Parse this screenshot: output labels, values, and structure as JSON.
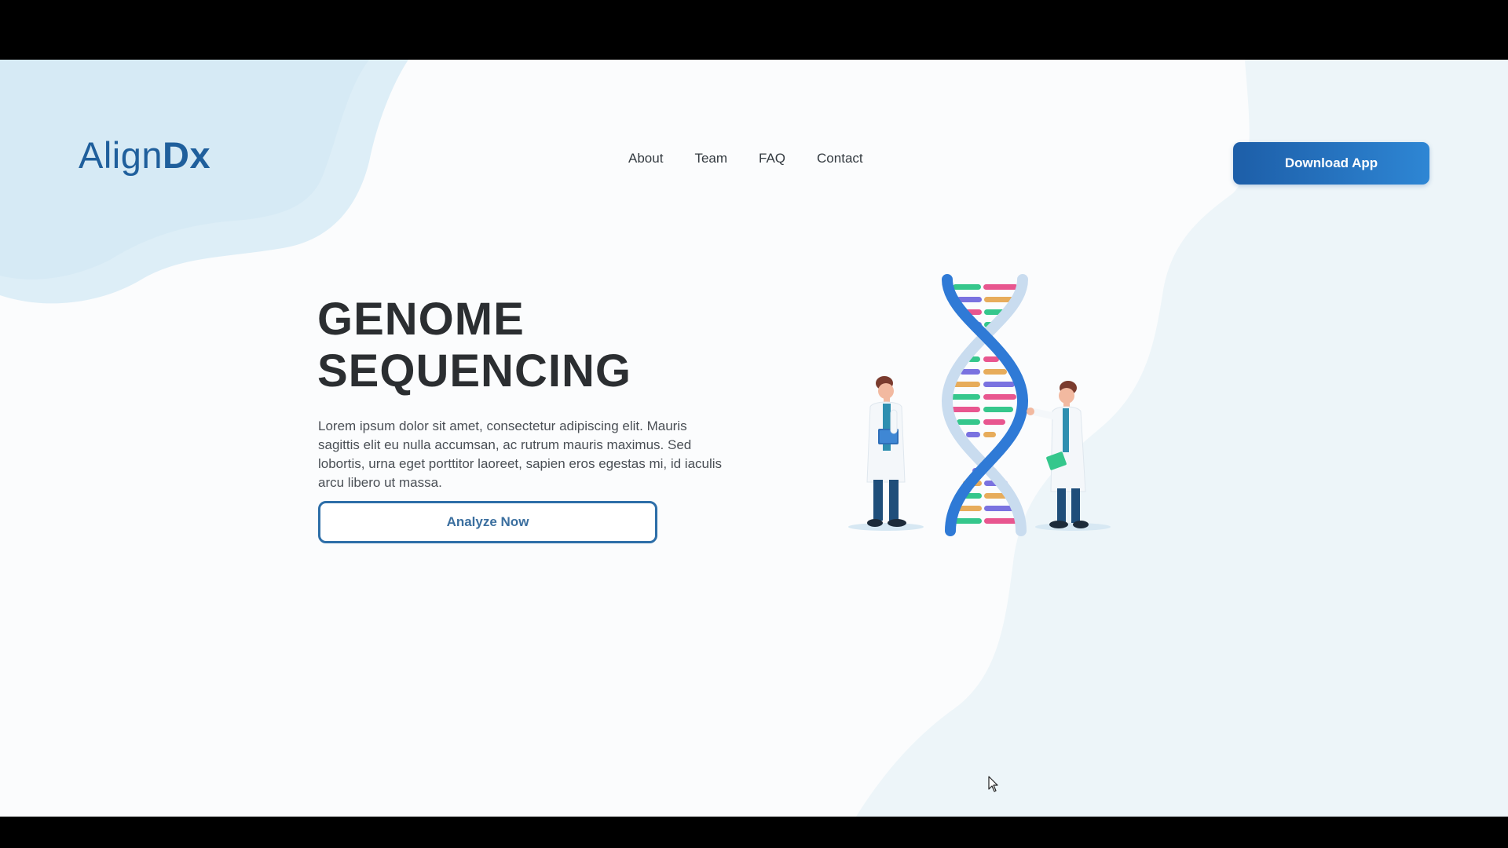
{
  "brand": {
    "name_light": "Align",
    "name_bold": "Dx",
    "color": "#1f5f9c"
  },
  "nav": {
    "items": [
      {
        "label": "About"
      },
      {
        "label": "Team"
      },
      {
        "label": "FAQ"
      },
      {
        "label": "Contact"
      }
    ]
  },
  "header": {
    "download_label": "Download App"
  },
  "hero": {
    "title_line1": "GENOME",
    "title_line2": "SEQUENCING",
    "description": "Lorem ipsum dolor sit amet, consectetur adipiscing elit. Mauris sagittis elit eu nulla accumsan, ac rutrum mauris maximus. Sed lobortis, urna eget porttitor laoreet, sapien eros egestas mi, id iaculis arcu libero ut massa.",
    "cta_label": "Analyze Now"
  },
  "illustration": {
    "name": "dna-scientists-illustration",
    "helix_color": "#2f7ad6",
    "base_pair_colors": [
      "#35c78c",
      "#e8568f",
      "#7a72e0",
      "#e7ac5b"
    ]
  },
  "colors": {
    "accent": "#2d6ea8",
    "text_dark": "#2b2e31",
    "background": "#fbfcfd",
    "blob": "#dcedf6"
  }
}
